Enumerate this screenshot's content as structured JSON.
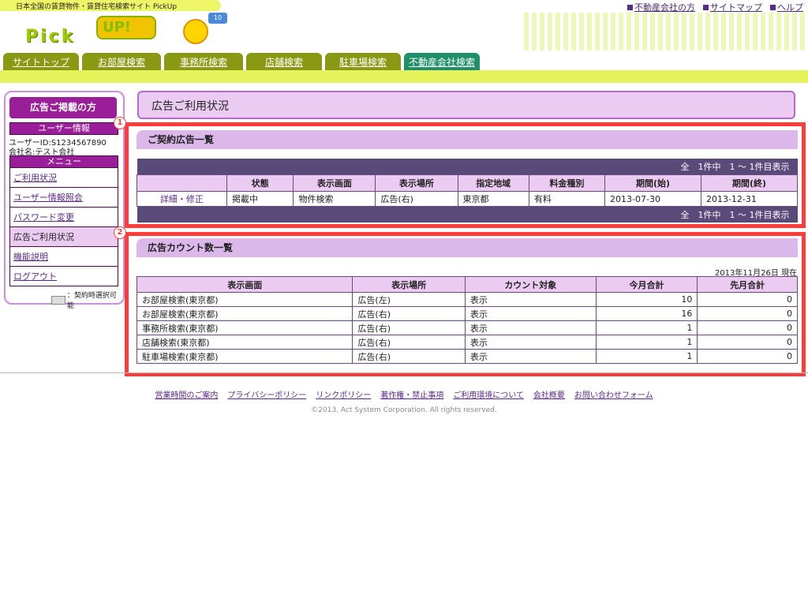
{
  "header": {
    "tagline": "日本全国の賃貸物件・賃貸住宅検索サイト PickUp",
    "logo_text": "Pick",
    "logo_bubble": "UP!",
    "logo_flag": "10",
    "top_links": [
      "不動産会社の方",
      "サイトマップ",
      "ヘルプ"
    ]
  },
  "tabs": [
    {
      "label": "サイトトップ",
      "active": false
    },
    {
      "label": "お部屋検索",
      "active": false
    },
    {
      "label": "事務所検索",
      "active": false
    },
    {
      "label": "店舗検索",
      "active": false
    },
    {
      "label": "駐車場検索",
      "active": false
    },
    {
      "label": "不動産会社検索",
      "active": true
    }
  ],
  "sidebar": {
    "head": "広告ご掲載の方",
    "user_section": "ユーザー情報",
    "user_id": "ユーザーID:S1234567890",
    "company": "会社名:テスト会社",
    "menu_section": "メニュー",
    "menu": [
      {
        "label": "ご利用状況",
        "link": true
      },
      {
        "label": "ユーザー情報照会",
        "link": true
      },
      {
        "label": "パスワード変更",
        "link": true
      },
      {
        "label": "広告ご利用状況",
        "link": false
      },
      {
        "label": "機能説明",
        "link": true
      },
      {
        "label": "ログアウト",
        "link": true
      }
    ],
    "legend": "：契約時選択可能"
  },
  "page_title": "広告ご利用状況",
  "markers": [
    "1",
    "2"
  ],
  "contracts": {
    "title": "ご契約広告一覧",
    "pager": "全　1件中　1 ～ 1件目表示",
    "columns": [
      "",
      "状態",
      "表示画面",
      "表示場所",
      "指定地域",
      "料金種別",
      "期間(始)",
      "期間(終)"
    ],
    "rows": [
      [
        "詳細・修正",
        "掲載中",
        "物件検索",
        "広告(右)",
        "東京都",
        "有料",
        "2013-07-30",
        "2013-12-31"
      ]
    ]
  },
  "counts": {
    "title": "広告カウント数一覧",
    "as_of": "2013年11月26日 現在",
    "columns": [
      "表示画面",
      "表示場所",
      "カウント対象",
      "今月合計",
      "先月合計"
    ],
    "rows": [
      [
        "お部屋検索(東京都)",
        "広告(左)",
        "表示",
        "10",
        "0"
      ],
      [
        "お部屋検索(東京都)",
        "広告(右)",
        "表示",
        "16",
        "0"
      ],
      [
        "事務所検索(東京都)",
        "広告(右)",
        "表示",
        "1",
        "0"
      ],
      [
        "店舗検索(東京都)",
        "広告(右)",
        "表示",
        "1",
        "0"
      ],
      [
        "駐車場検索(東京都)",
        "広告(右)",
        "表示",
        "1",
        "0"
      ]
    ]
  },
  "footer": {
    "links": [
      "営業時間のご案内",
      "プライバシーポリシー",
      "リンクポリシー",
      "著作権・禁止事項",
      "ご利用環境について",
      "会社概要",
      "お問い合わせフォーム"
    ],
    "copyright": "©2013. Act System Corporation. All rights reserved."
  },
  "colors": {
    "tab": "#8a9914",
    "tab_active": "#1f8f6a",
    "accent": "#9a1e9a",
    "highlight": "#ff3c3c"
  }
}
